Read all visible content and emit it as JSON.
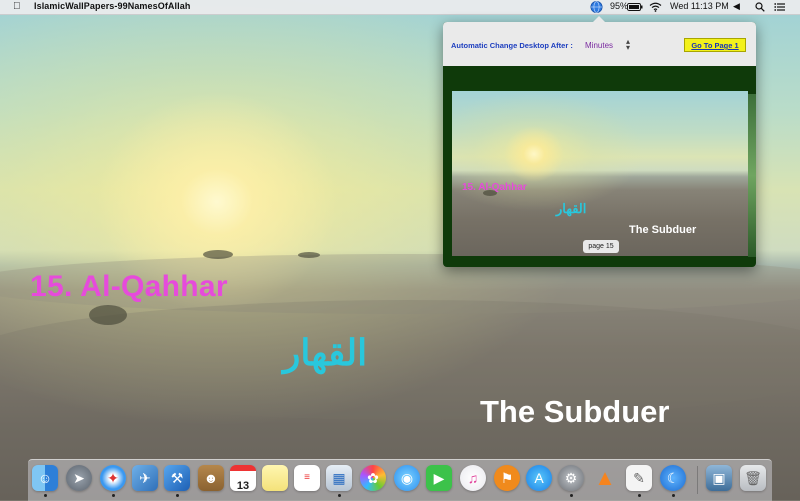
{
  "menubar": {
    "apple_icon": "apple-logo",
    "app_name": "IslamicWallPapers-99NamesOfAllah",
    "status_icon": "globe-status-icon",
    "battery_percent": "95%",
    "clock": "Wed 11:13 PM"
  },
  "wallpaper": {
    "name_number": "15. Al-Qahhar",
    "arabic_name": "القهار",
    "english_meaning": "The Subduer"
  },
  "popover": {
    "label": "Automatic Change Desktop After :",
    "interval_value": "Minutes",
    "go_button": "Go To Page 1",
    "preview": {
      "name_number": "15. Al-Qahhar",
      "arabic_name": "القهار",
      "english_meaning": "The Subduer",
      "page_indicator": "page 15"
    }
  },
  "dock": {
    "calendar_date": "13"
  },
  "colors": {
    "name_magenta": "#e64bdb",
    "arabic_cyan": "#29c7dc",
    "button_yellow": "#f3f11b",
    "label_blue": "#1e3fbf"
  }
}
